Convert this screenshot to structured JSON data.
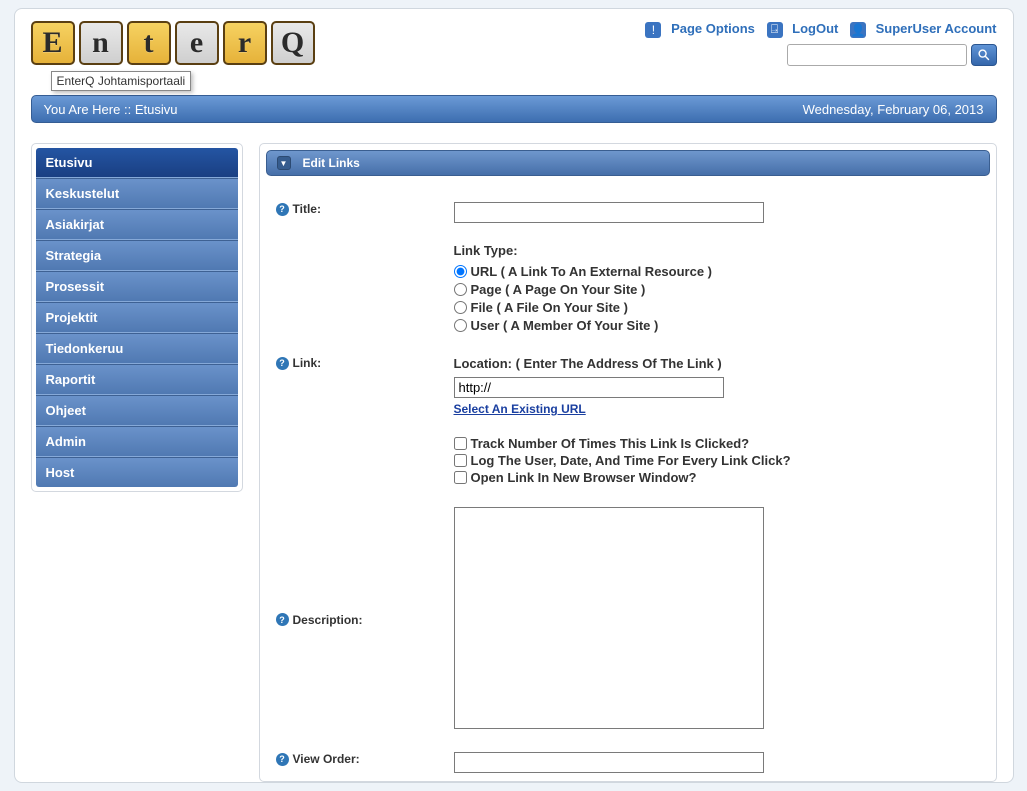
{
  "logo": {
    "letters": [
      "E",
      "n",
      "t",
      "e",
      "r",
      "Q"
    ],
    "tooltip": "EnterQ Johtamisportaali"
  },
  "toplinks": {
    "page_options": "Page Options",
    "logout": "LogOut",
    "account": "SuperUser Account"
  },
  "breadcrumb": {
    "prefix": "You Are Here :: ",
    "current": "Etusivu",
    "date": "Wednesday, February 06, 2013"
  },
  "sidebar": {
    "items": [
      {
        "label": "Etusivu",
        "active": true
      },
      {
        "label": "Keskustelut",
        "active": false
      },
      {
        "label": "Asiakirjat",
        "active": false
      },
      {
        "label": "Strategia",
        "active": false
      },
      {
        "label": "Prosessit",
        "active": false
      },
      {
        "label": "Projektit",
        "active": false
      },
      {
        "label": "Tiedonkeruu",
        "active": false
      },
      {
        "label": "Raportit",
        "active": false
      },
      {
        "label": "Ohjeet",
        "active": false
      },
      {
        "label": "Admin",
        "active": false
      },
      {
        "label": "Host",
        "active": false
      }
    ]
  },
  "panel": {
    "title": "Edit Links"
  },
  "form": {
    "title_label": "Title:",
    "title_value": "",
    "linktype_label": "Link Type:",
    "linktype_options": [
      {
        "label": "URL ( A Link To An External Resource )",
        "selected": true
      },
      {
        "label": "Page ( A Page On Your Site )",
        "selected": false
      },
      {
        "label": "File ( A File On Your Site )",
        "selected": false
      },
      {
        "label": "User ( A Member Of Your Site )",
        "selected": false
      }
    ],
    "link_label": "Link:",
    "location_label": "Location: ( Enter The Address Of The Link )",
    "location_value": "http://",
    "select_existing": "Select An Existing URL",
    "check_track": "Track Number Of Times This Link Is Clicked?",
    "check_log": "Log The User, Date, And Time For Every Link Click?",
    "check_newwin": "Open Link In New Browser Window?",
    "description_label": "Description:",
    "description_value": "",
    "vieworder_label": "View Order:",
    "vieworder_value": ""
  }
}
